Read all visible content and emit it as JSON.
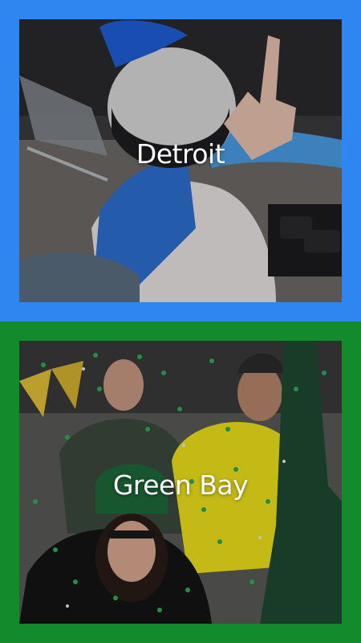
{
  "cities": [
    {
      "name": "Detroit",
      "frame_color": "#2f86f0",
      "photo": "fan-with-helmet-peace-sign"
    },
    {
      "name": "Green Bay",
      "frame_color": "#138a2b",
      "photo": "fans-celebrating-with-confetti"
    }
  ]
}
